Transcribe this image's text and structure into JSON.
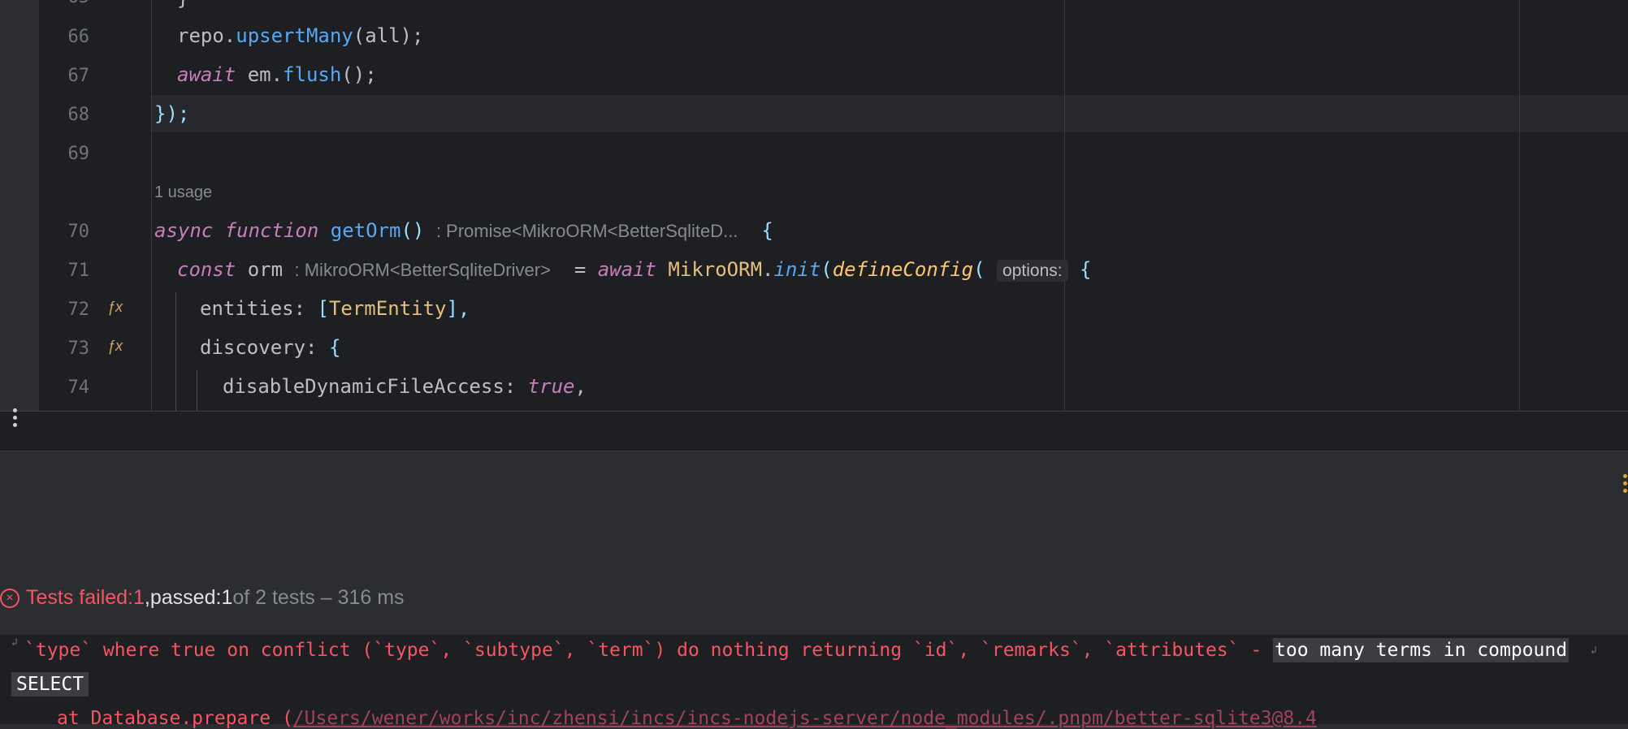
{
  "editor": {
    "lines": [
      {
        "num": "65",
        "partial": true
      },
      {
        "num": "66"
      },
      {
        "num": "67"
      },
      {
        "num": "68"
      },
      {
        "num": "69"
      },
      {
        "num": "70"
      },
      {
        "num": "71"
      },
      {
        "num": "72"
      },
      {
        "num": "73"
      },
      {
        "num": "74"
      }
    ],
    "code": {
      "l65": "}",
      "l66_obj": "repo.",
      "l66_fn": "upsertMany",
      "l66_rest": "(all);",
      "l67_kw": "await",
      "l67_obj": " em.",
      "l67_fn": "flush",
      "l67_rest": "();",
      "l68": "});",
      "usage": "1 usage",
      "l70_kw1": "async",
      "l70_kw2": "function",
      "l70_fn": "getOrm",
      "l70_paren": "()",
      "l70_hint": ": Promise<MikroORM<BetterSqliteD...",
      "l70_brace": "{",
      "l71_kw": "const",
      "l71_var": " orm ",
      "l71_hint": ": MikroORM<BetterSqliteDriver>",
      "l71_eq": " = ",
      "l71_await": "await",
      "l71_cls": " MikroORM",
      "l71_dot": ".",
      "l71_fn": "init",
      "l71_paren": "(",
      "l71_call": "defineConfig",
      "l71_paren2": "(",
      "l71_param": "options:",
      "l71_brace": " {",
      "l72_prop": "entities: ",
      "l72_open": "[",
      "l72_cls": "TermEntity",
      "l72_close": "],",
      "l73_prop": "discovery: ",
      "l73_brace": "{",
      "l74_prop": "disableDynamicFileAccess: ",
      "l74_val": "true",
      "l74_comma": ","
    },
    "gutter_icons": [
      "fx-icon",
      "fx-icon"
    ]
  },
  "results": {
    "failed_label": "Tests failed: ",
    "failed_count": "1",
    "sep": ", ",
    "passed_label": "passed: ",
    "passed_count": "1",
    "of_text": " of 2 tests – 316 ms"
  },
  "console": {
    "line1_err": "`type` where true on conflict (`type`, `subtype`, `term`) do nothing returning `id`, `remarks`, `attributes` - ",
    "line1_highlight": "too many terms in compound",
    "line2": "SELECT",
    "line3_err": "at Database.prepare (",
    "line3_path": "/Users/wener/works/inc/zhensi/incs/incs-nodejs-server/node_modules/.pnpm/better-sqlite3@8.4"
  },
  "colors": {
    "error": "#f75464",
    "keyword": "#c77dbb",
    "function": "#56a8f5",
    "class": "#e5c07b"
  }
}
